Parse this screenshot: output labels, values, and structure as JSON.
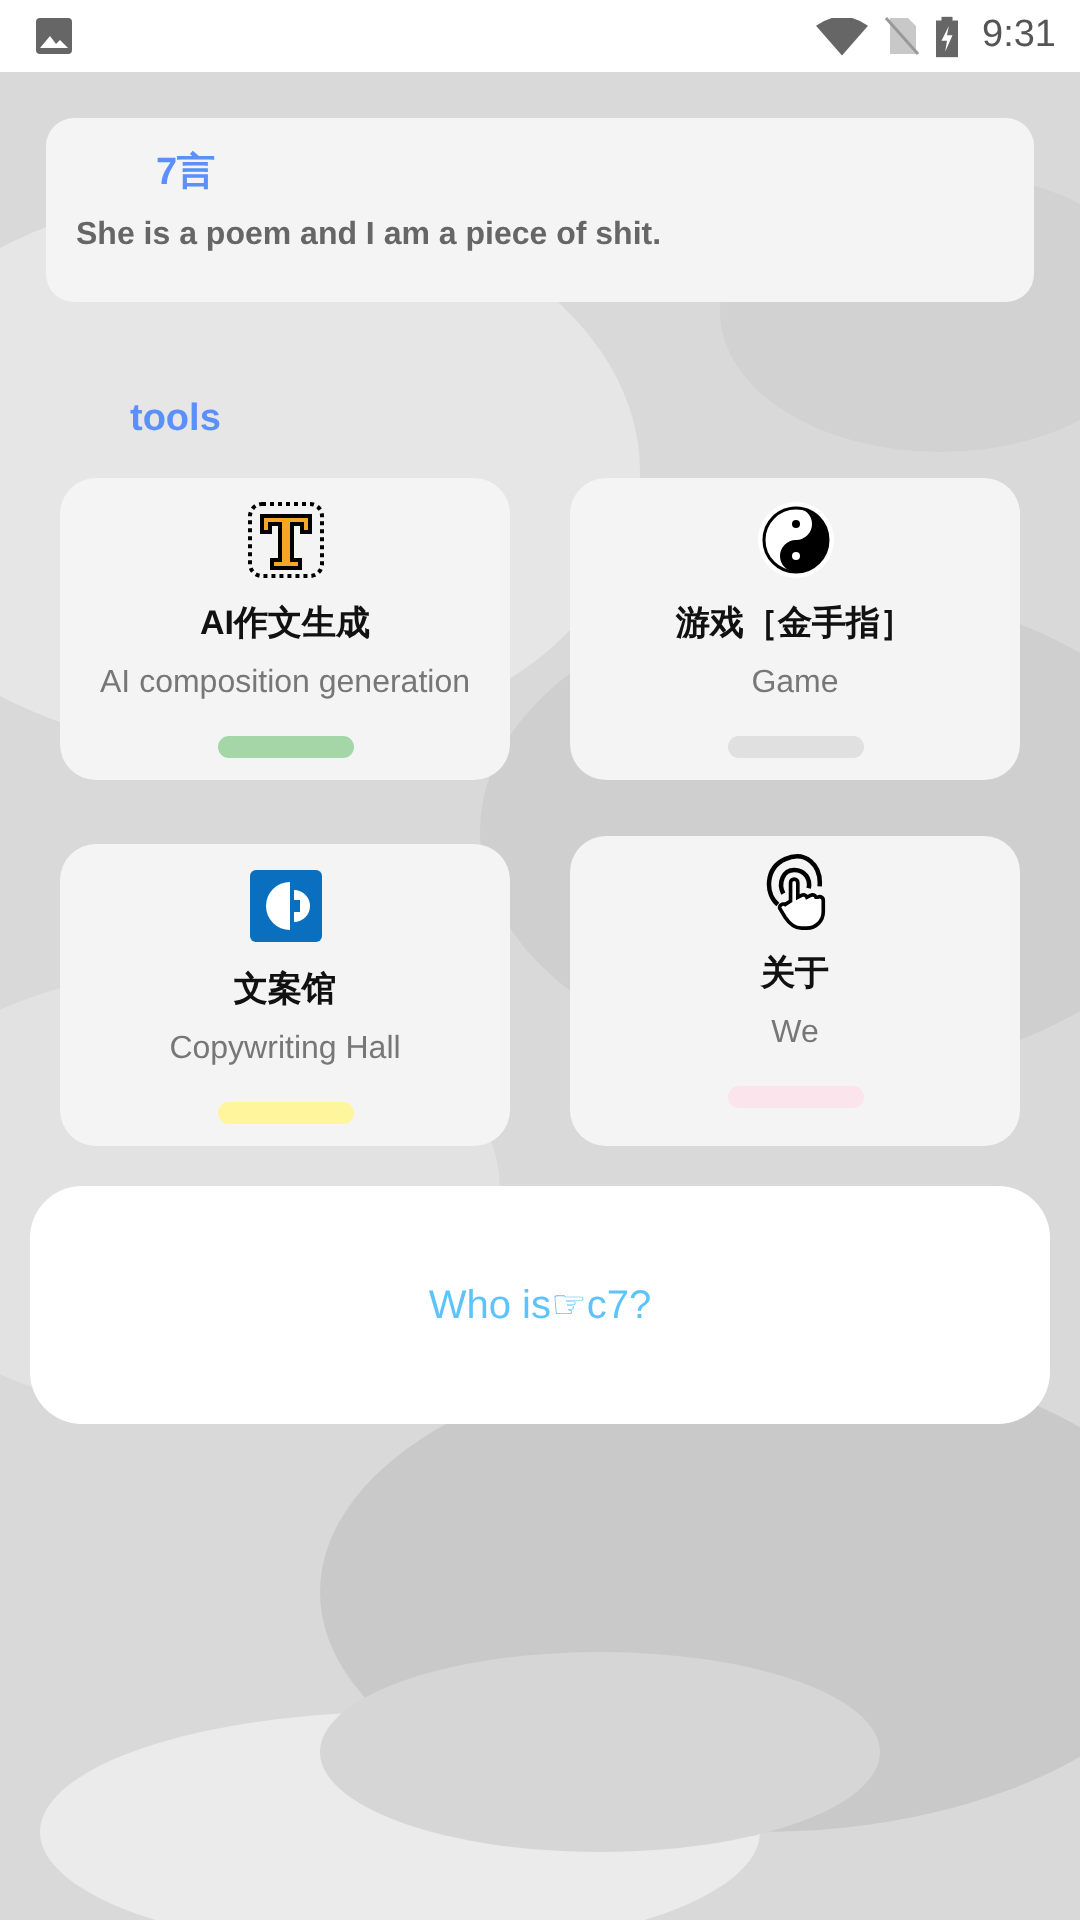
{
  "status_bar": {
    "time": "9:31"
  },
  "quote": {
    "title": "7言",
    "text": "She is a poem and I am a piece of shit."
  },
  "section_title": "tools",
  "tools": [
    {
      "title": "AI作文生成",
      "subtitle": "AI composition generation",
      "color": "#a5d6a7"
    },
    {
      "title": "游戏［金手指］",
      "subtitle": "Game",
      "color": "#e0e0e0"
    },
    {
      "title": "文案馆",
      "subtitle": "Copywriting Hall",
      "color": "#fff59d"
    },
    {
      "title": "关于",
      "subtitle": "We",
      "color": "#fce4ec"
    }
  ],
  "footer_card": {
    "text": "Who is☞c7?"
  }
}
